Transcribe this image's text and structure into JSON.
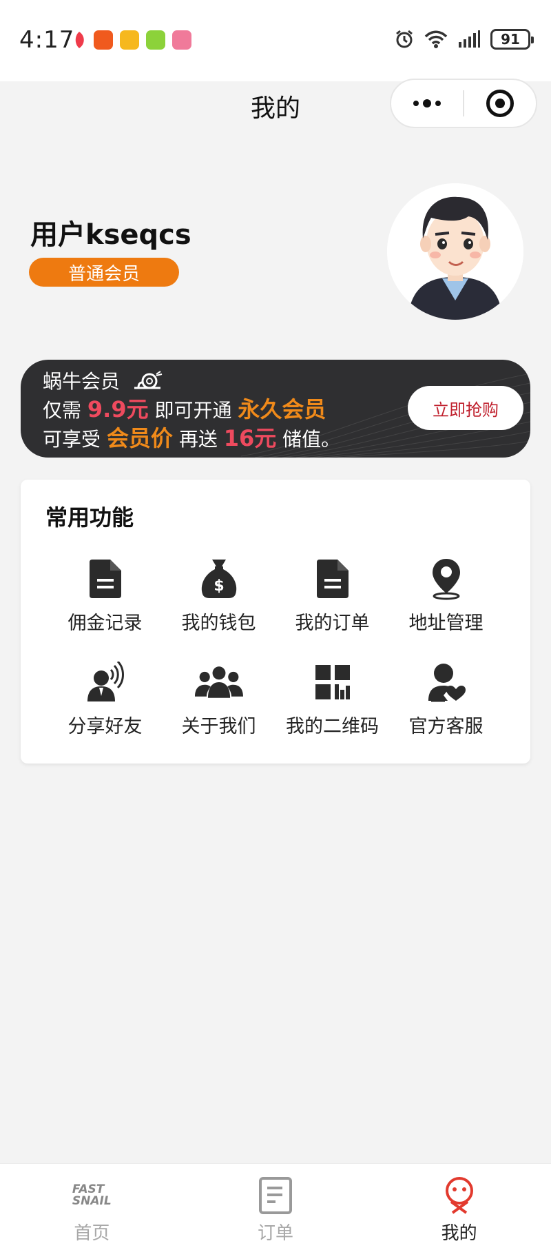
{
  "status_bar": {
    "time": "4:17",
    "battery": "91",
    "notification_icons": [
      "red-leaf-icon",
      "orange-app-icon",
      "mail-icon",
      "green-android-icon",
      "pink-book-icon"
    ],
    "right_icons": [
      "alarm-icon",
      "wifi-icon",
      "signal-icon",
      "battery-icon"
    ]
  },
  "nav": {
    "title": "我的",
    "menu_icon": "more-dots-icon",
    "close_icon": "target-circle-icon"
  },
  "profile": {
    "user_name": "用户kseqcs",
    "member_level": "普通会员",
    "avatar": "cartoon-avatar"
  },
  "promo": {
    "line1": "蜗牛会员",
    "line2_prefix": "仅需 ",
    "line2_price": "9.9元",
    "line2_mid": " 即可开通 ",
    "line2_highlight": "永久会员",
    "line3_prefix": "可享受 ",
    "line3_highlight": "会员价",
    "line3_mid": " 再送 ",
    "line3_amount": "16元",
    "line3_suffix": " 储值。",
    "button": "立即抢购",
    "colors": {
      "red": "#ee4a5e",
      "orange": "#f08a1a",
      "bg": "#2f2f31"
    }
  },
  "features": {
    "title": "常用功能",
    "items": [
      {
        "label": "佣金记录",
        "icon": "document-icon"
      },
      {
        "label": "我的钱包",
        "icon": "money-bag-icon"
      },
      {
        "label": "我的订单",
        "icon": "order-document-icon"
      },
      {
        "label": "地址管理",
        "icon": "location-pin-icon"
      },
      {
        "label": "分享好友",
        "icon": "share-person-icon"
      },
      {
        "label": "关于我们",
        "icon": "group-icon"
      },
      {
        "label": "我的二维码",
        "icon": "qr-code-icon"
      },
      {
        "label": "官方客服",
        "icon": "customer-service-icon"
      }
    ]
  },
  "tabbar": {
    "items": [
      {
        "label": "首页",
        "icon": "fast-snail-logo-icon",
        "logo_text_1": "FAST",
        "logo_text_2": "SNAIL"
      },
      {
        "label": "订单",
        "icon": "order-tab-icon"
      },
      {
        "label": "我的",
        "icon": "mine-tab-icon",
        "active": true
      }
    ],
    "accent": "#e23a2e"
  }
}
